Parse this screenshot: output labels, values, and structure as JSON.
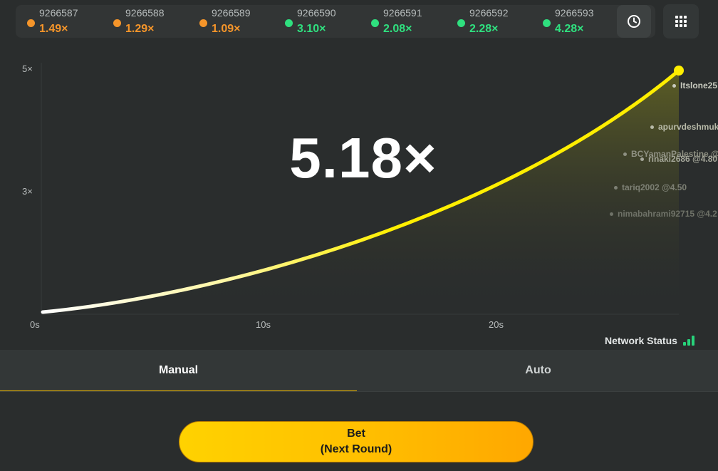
{
  "history": [
    {
      "round": "9266587",
      "multiplier": "1.49×",
      "status": "low",
      "color": "#f5952a"
    },
    {
      "round": "9266588",
      "multiplier": "1.29×",
      "status": "low",
      "color": "#f5952a"
    },
    {
      "round": "9266589",
      "multiplier": "1.09×",
      "status": "low",
      "color": "#f5952a"
    },
    {
      "round": "9266590",
      "multiplier": "3.10×",
      "status": "high",
      "color": "#2fe07f"
    },
    {
      "round": "9266591",
      "multiplier": "2.08×",
      "status": "high",
      "color": "#2fe07f"
    },
    {
      "round": "9266592",
      "multiplier": "2.28×",
      "status": "high",
      "color": "#2fe07f"
    },
    {
      "round": "9266593",
      "multiplier": "4.28×",
      "status": "high",
      "color": "#2fe07f"
    }
  ],
  "toolbar": {
    "history_icon": "clock-icon",
    "menu_icon": "grid-icon"
  },
  "chart": {
    "current_multiplier": "5.18×",
    "y_ticks": [
      "5×",
      "3×"
    ],
    "x_ticks": [
      "0s",
      "10s",
      "20s"
    ],
    "line_color": "#ffee00",
    "players": [
      {
        "label": "Itslone25",
        "color": "#c9cbbf"
      },
      {
        "label": "apurvdeshmuk",
        "color": "#b8baa8"
      },
      {
        "label": "BCYamanPalestine @",
        "color": "#8e9082"
      },
      {
        "label": "rinaki2686 @4.80",
        "color": "#a5a79a"
      },
      {
        "label": "tariq2002 @4.50",
        "color": "#7d8074"
      },
      {
        "label": "nimabahrami92715 @4.2",
        "color": "#6f7268"
      }
    ]
  },
  "network": {
    "label": "Network Status",
    "color": "#27d37a"
  },
  "tabs": [
    {
      "label": "Manual",
      "active": true
    },
    {
      "label": "Auto",
      "active": false
    }
  ],
  "bet_button": {
    "line1": "Bet",
    "line2": "(Next Round)"
  }
}
